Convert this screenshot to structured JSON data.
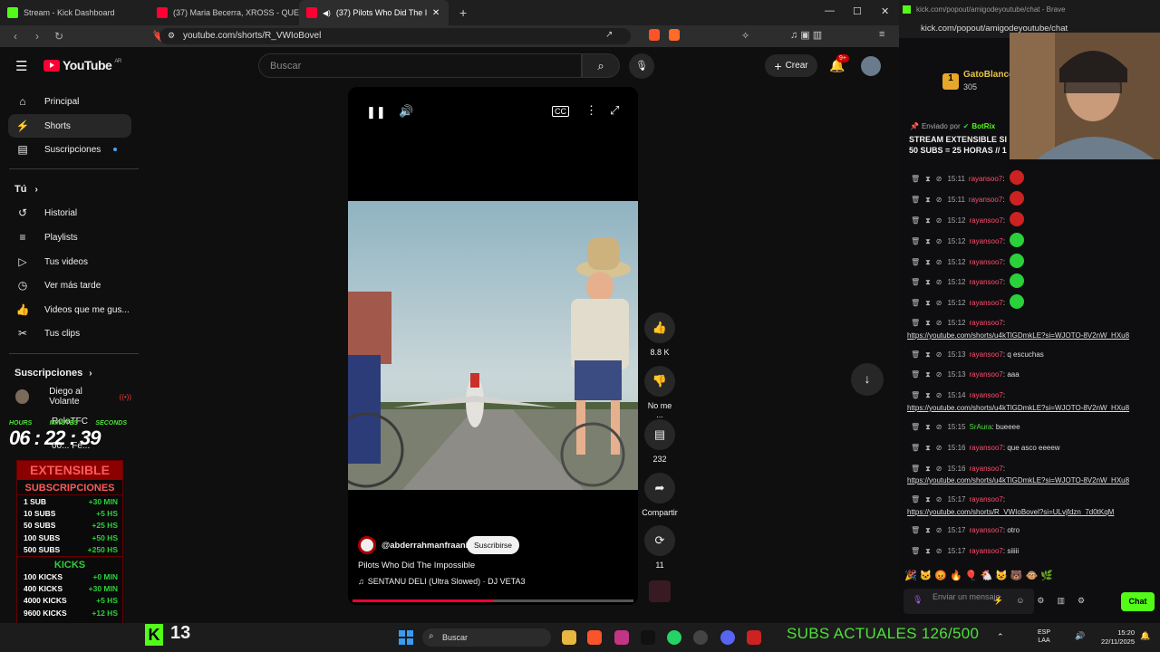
{
  "browser": {
    "tabs": [
      {
        "label": "Stream - Kick Dashboard"
      },
      {
        "label": "(37) Maria Becerra, XROSS - QUE TU"
      },
      {
        "label": "(37) Pilots Who Did The Impo"
      }
    ],
    "url": "youtube.com/shorts/R_VWIoBovel"
  },
  "chat_window": {
    "title": "kick.com/popout/amigodeyoutube/chat - Brave",
    "url": "kick.com/popout/amigodeyoutube/chat"
  },
  "youtube": {
    "logo_text": "YouTube",
    "region": "AR",
    "search_placeholder": "Buscar",
    "create_label": "Crear",
    "notif_badge": "9+",
    "sidebar": {
      "items": [
        {
          "label": "Principal"
        },
        {
          "label": "Shorts"
        },
        {
          "label": "Suscripciones"
        }
      ],
      "you_header": "Tú",
      "you_items": [
        {
          "label": "Historial"
        },
        {
          "label": "Playlists"
        },
        {
          "label": "Tus videos"
        },
        {
          "label": "Ver más tarde"
        },
        {
          "label": "Videos que me gus..."
        },
        {
          "label": "Tus clips"
        }
      ],
      "subs_header": "Suscripciones",
      "subs_items": [
        {
          "label": "Diego al Volante"
        },
        {
          "label": "RoloTFC"
        },
        {
          "label": "00... Fe..."
        }
      ]
    },
    "short": {
      "channel": "@abderrahmanfraani",
      "subscribe_label": "Suscribirse",
      "title": "Pilots Who Did The Impossible",
      "music": "SENTANU DELI (Ultra Slowed) · DJ VETA3",
      "progress": 0.5
    },
    "actions": {
      "likes": "8.8 K",
      "dislike": "No me ...",
      "comments": "232",
      "share": "Compartir",
      "remix": "11"
    }
  },
  "kick_chat": {
    "leader_name": "GatoBlanco",
    "leader_count": "305",
    "pinned_by": "Enviado por",
    "pinned_user": "BotRix",
    "pinned_line1": "STREAM EXTENSIBLE SI",
    "pinned_line2": "50 SUBS = 25 HORAS // 1",
    "messages": [
      {
        "time": "15:11",
        "user": "rayansoo7",
        "text": ":"
      },
      {
        "time": "15:11",
        "user": "rayansoo7",
        "text": ":"
      },
      {
        "time": "15:12",
        "user": "rayansoo7",
        "text": ":"
      },
      {
        "time": "15:12",
        "user": "rayansoo7",
        "text": ":"
      },
      {
        "time": "15:12",
        "user": "rayansoo7",
        "text": ":"
      },
      {
        "time": "15:12",
        "user": "rayansoo7",
        "text": ":"
      },
      {
        "time": "15:12",
        "user": "rayansoo7",
        "text": ":"
      },
      {
        "time": "15:12",
        "user": "rayansoo7",
        "text": ":"
      },
      {
        "time": "15:13",
        "user": "rayansoo7",
        "text": ": q escuchas"
      },
      {
        "time": "15:13",
        "user": "rayansoo7",
        "text": ": aaa"
      },
      {
        "time": "15:14",
        "user": "rayansoo7",
        "text": ":"
      },
      {
        "time": "15:15",
        "user": "SrAura",
        "text": ": bueeee"
      },
      {
        "time": "15:16",
        "user": "rayansoo7",
        "text": ": que asco eeeew"
      },
      {
        "time": "15:16",
        "user": "rayansoo7",
        "text": ":"
      },
      {
        "time": "15:17",
        "user": "rayansoo7",
        "text": ":"
      },
      {
        "time": "15:17",
        "user": "rayansoo7",
        "text": ": otro"
      },
      {
        "time": "15:17",
        "user": "rayansoo7",
        "text": ": siiiii"
      }
    ],
    "links": [
      "https://youtube.com/shorts/u4kTlGDmkLE?si=WJOTO-8V2nW_HXu8",
      "https://youtube.com/shorts/u4kTlGDmkLE?si=WJOTO-8V2nW_HXu8",
      "https://youtube.com/shorts/u4kTlGDmkLE?si=WJOTO-8V2nW_HXu8",
      "https://youtube.com/shorts/R_VWIoBovel?si=ULvjfdzn_7d0tKqM"
    ],
    "input_placeholder": "Enviar un mensaje",
    "chat_button": "Chat"
  },
  "stream_overlay": {
    "timer_labels": [
      "HOURS",
      "MINUTES",
      "SECONDS"
    ],
    "timer": "06 : 22 : 39",
    "extensible": "EXTENSIBLE",
    "subscriptions_header": "SUBSCRIPCIONES",
    "subs_rows": [
      {
        "l": "1 SUB",
        "r": "+30 MIN"
      },
      {
        "l": "10 SUBS",
        "r": "+5 HS"
      },
      {
        "l": "50 SUBS",
        "r": "+25 HS"
      },
      {
        "l": "100 SUBS",
        "r": "+50 HS"
      },
      {
        "l": "500 SUBS",
        "r": "+250 HS"
      }
    ],
    "kicks_header": "KICKS",
    "kicks_rows": [
      {
        "l": "100 KICKS",
        "r": "+0 MIN"
      },
      {
        "l": "400 KICKS",
        "r": "+30 MIN"
      },
      {
        "l": "4000 KICKS",
        "r": "+5 HS"
      },
      {
        "l": "9600 KICKS",
        "r": "+12 HS"
      }
    ],
    "kick_count": "13",
    "subs_current": "SUBS ACTUALES 126/500"
  },
  "taskbar": {
    "search": "Buscar",
    "lang1": "ESP",
    "lang2": "LAA",
    "time": "15:20",
    "date": "22/11/2025"
  },
  "colors": {
    "accent": "#ff0033",
    "kick_green": "#53fc18",
    "subs_green": "#2ad13a"
  }
}
